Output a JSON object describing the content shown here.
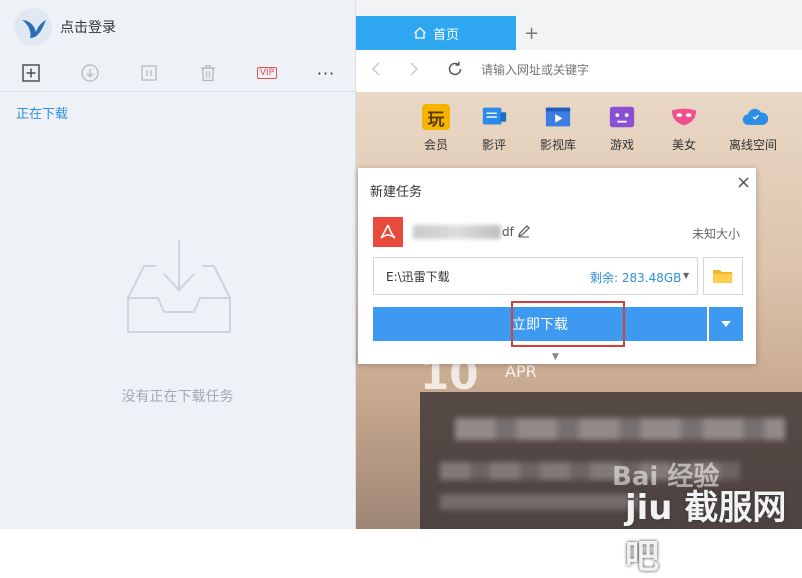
{
  "sidebar": {
    "login_text": "点击登录",
    "toolbar": {
      "vip_label": "VIP",
      "more_label": "···"
    },
    "downloading_tab": "正在下载",
    "empty_text": "没有正在下载任务"
  },
  "browser": {
    "home_tab": "首页",
    "new_tab_label": "+",
    "address_placeholder": "请输入网址或关键字",
    "quick_links": [
      {
        "label": "会员",
        "icon": "play-char-icon",
        "glyph": "玩",
        "color": "#f5b400"
      },
      {
        "label": "影评",
        "icon": "review-icon",
        "glyph": "",
        "color": "#2c8be8"
      },
      {
        "label": "影视库",
        "icon": "video-library-icon",
        "glyph": "",
        "color": "#3b7de0"
      },
      {
        "label": "游戏",
        "icon": "game-icon",
        "glyph": "",
        "color": "#8a4fd6"
      },
      {
        "label": "美女",
        "icon": "mask-icon",
        "glyph": "",
        "color": "#ef4f8d"
      },
      {
        "label": "离线空间",
        "icon": "cloud-icon",
        "glyph": "",
        "color": "#2b8ee8"
      }
    ],
    "date_day": "10",
    "date_month": "APR"
  },
  "dialog": {
    "title": "新建任务",
    "close_label": "×",
    "file_name_suffix": "df",
    "file_size": "未知大小",
    "save_path": "E:\\迅雷下载",
    "free_space": "剩余: 283.48GB",
    "download_button": "立即下载"
  },
  "watermark": {
    "baidu": "Bai 经验",
    "site": "jiu 截服网吧"
  },
  "colors": {
    "accent": "#2ea7f0",
    "button": "#3e9af0",
    "highlight": "#d43e3e",
    "pdf": "#e84b3c"
  }
}
